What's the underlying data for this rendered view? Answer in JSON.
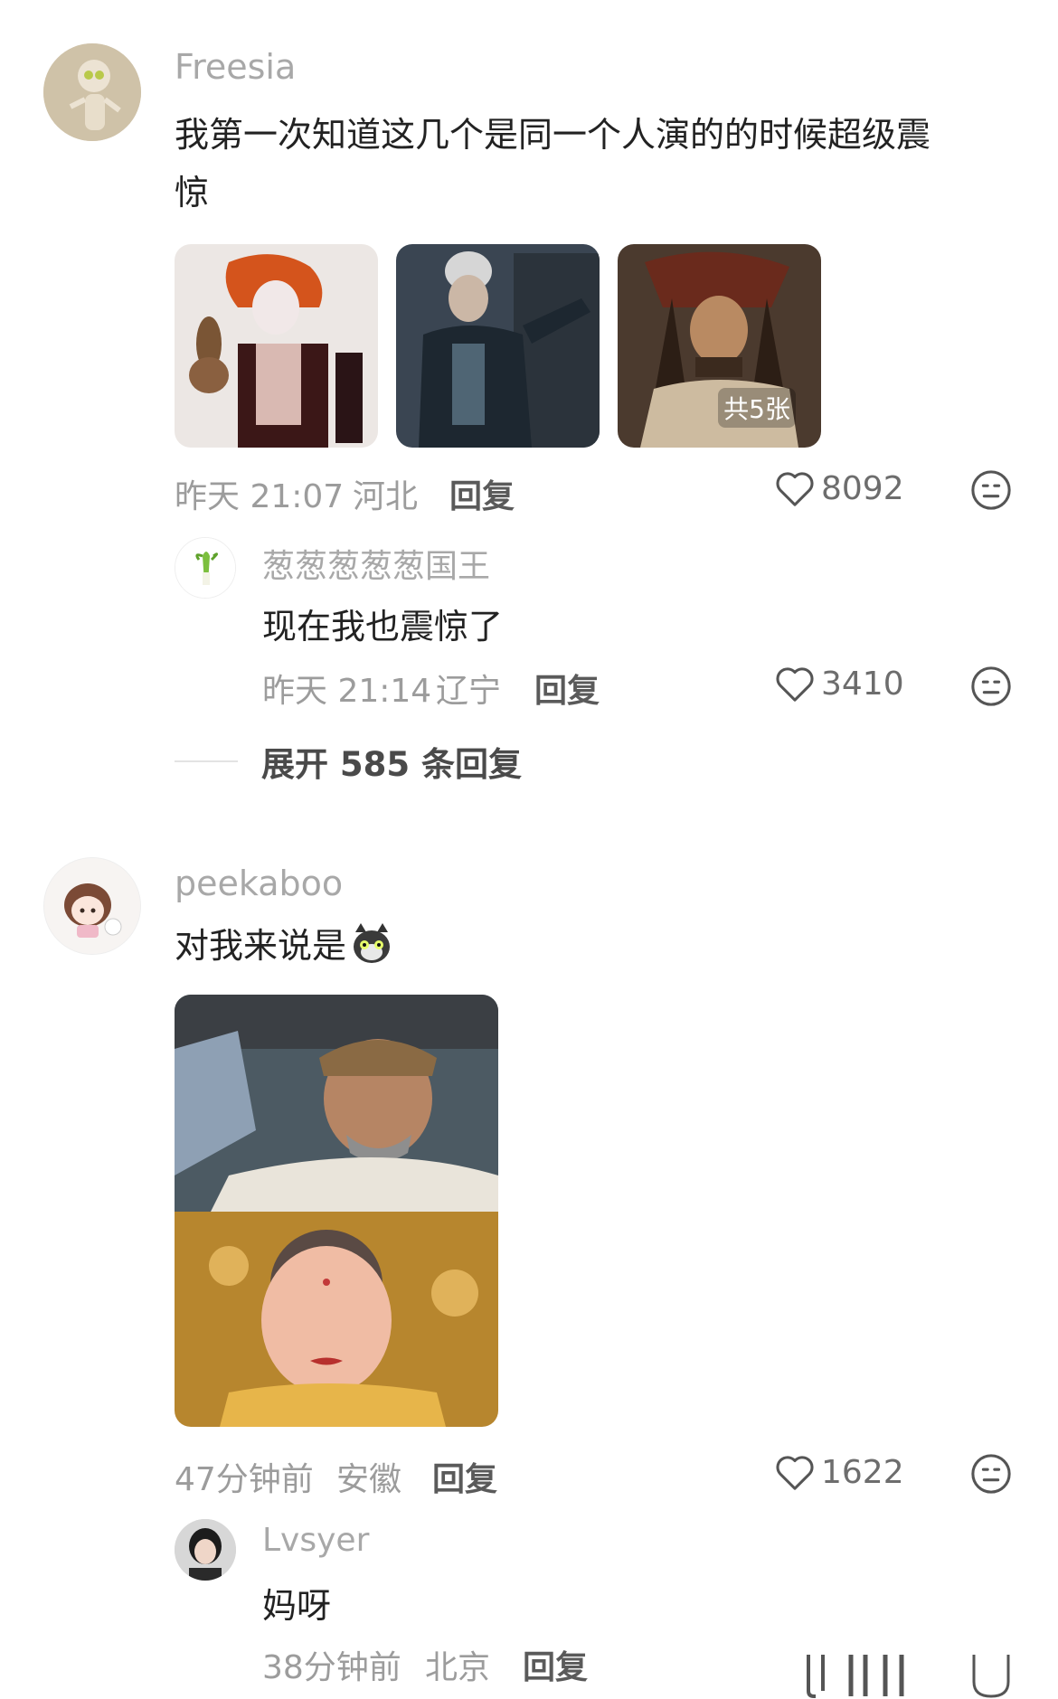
{
  "comments": [
    {
      "username": "Freesia",
      "text_line1": "我第一次知道这几个是同一个人演的的时候超级震",
      "text_line2": "惊",
      "images_more": "共5张",
      "time": "昨天 21:07",
      "location": "河北",
      "reply_label": "回复",
      "likes": "8092",
      "sub_reply": {
        "username": "葱葱葱葱葱国王",
        "text": "现在我也震惊了",
        "time": "昨天 21:14",
        "location": "辽宁",
        "reply_label": "回复",
        "likes": "3410"
      },
      "expand_label": "展开 585 条回复"
    },
    {
      "username": "peekaboo",
      "text": "对我来说是",
      "time": "47分钟前",
      "location": "安徽",
      "reply_label": "回复",
      "likes": "1622",
      "sub_reply": {
        "username": "Lvsyer",
        "text": "妈呀",
        "time": "38分钟前",
        "location": "北京",
        "reply_label": "回复"
      }
    }
  ],
  "icons": {
    "like": "heart-outline-icon",
    "dislike": "neutral-face-icon"
  },
  "colors": {
    "username": "#a8a8a8",
    "content": "#222222",
    "meta": "#9c9c9c"
  }
}
